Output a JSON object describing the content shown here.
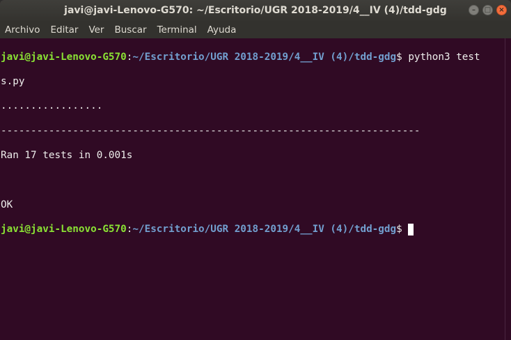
{
  "window": {
    "title": "javi@javi-Lenovo-G570: ~/Escritorio/UGR 2018-2019/4__IV (4)/tdd-gdg",
    "controls": {
      "minimize": "–",
      "maximize": "□",
      "close": "×"
    }
  },
  "menu": [
    "Archivo",
    "Editar",
    "Ver",
    "Buscar",
    "Terminal",
    "Ayuda"
  ],
  "terminal": {
    "prompt1": {
      "user": "javi@javi-Lenovo-G570",
      "sep": ":",
      "path": "~/Escritorio/UGR 2018-2019/4__IV (4)/tdd-gdg",
      "dollar": "$ ",
      "command": "python3 test",
      "command_wrap": "s.py"
    },
    "output": {
      "dots": ".................",
      "dashes": "----------------------------------------------------------------------",
      "ran": "Ran 17 tests in 0.001s",
      "blank": "",
      "ok": "OK"
    },
    "prompt2": {
      "user": "javi@javi-Lenovo-G570",
      "sep": ":",
      "path": "~/Escritorio/UGR 2018-2019/4__IV (4)/tdd-gdg",
      "dollar": "$"
    }
  },
  "colors": {
    "background": "#300a24",
    "user": "#8ae234",
    "path": "#729fcf",
    "text": "#eeeeec"
  }
}
